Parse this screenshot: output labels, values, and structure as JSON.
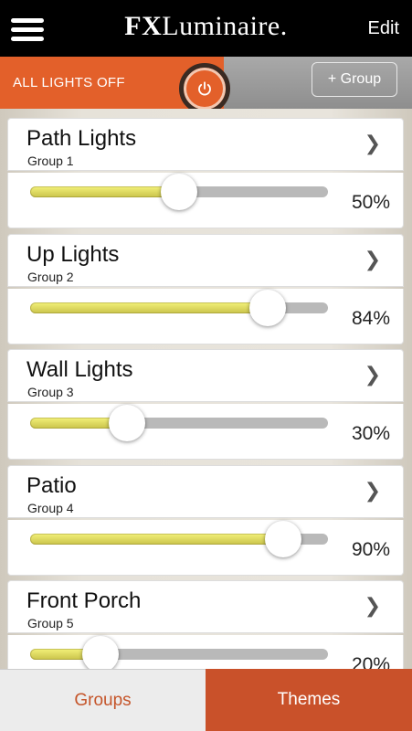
{
  "header": {
    "logo_bold": "FX",
    "logo_rest": "Luminaire",
    "logo_mark": ".",
    "edit_label": "Edit"
  },
  "toolbar": {
    "all_off_label": "ALL LIGHTS OFF",
    "add_group_label": "+ Group",
    "power_icon": "power-icon"
  },
  "groups": [
    {
      "name": "Path Lights",
      "group": "Group 1",
      "level": 50,
      "level_label": "50%"
    },
    {
      "name": "Up Lights",
      "group": "Group 2",
      "level": 84,
      "level_label": "84%"
    },
    {
      "name": "Wall Lights",
      "group": "Group 3",
      "level": 30,
      "level_label": "30%"
    },
    {
      "name": "Patio",
      "group": "Group 4",
      "level": 90,
      "level_label": "90%"
    },
    {
      "name": "Front Porch",
      "group": "Group 5",
      "level": 20,
      "level_label": "20%"
    }
  ],
  "tabs": {
    "groups_label": "Groups",
    "themes_label": "Themes"
  },
  "colors": {
    "accent": "#e3602a",
    "tab_active": "#c9512a",
    "slider_fill": "#f3f17a"
  }
}
